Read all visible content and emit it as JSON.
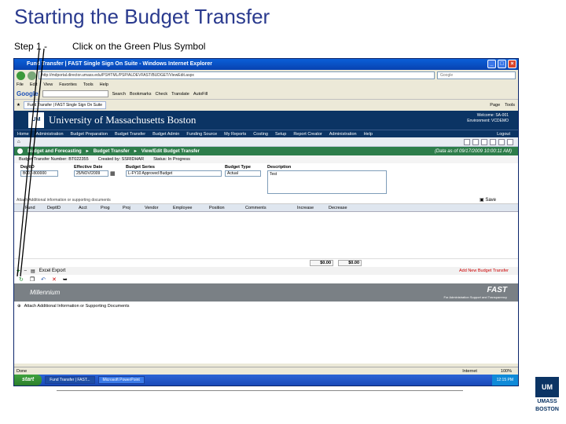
{
  "slide": {
    "title": "Starting the Budget Transfer",
    "step_label": "Step 1 -",
    "step_text": "Click on the Green Plus Symbol"
  },
  "browser": {
    "window_title": "Fund Transfer | FAST Single Sign On Suite - Windows Internet Explorer",
    "address": "http://mdportal.director.umass.edu/PSHTML/PSP/ALDEVFAST/BUDGET/ViewEdit.aspx",
    "search_placeholder": "Google",
    "menu": [
      "File",
      "Edit",
      "View",
      "Favorites",
      "Tools",
      "Help"
    ],
    "google_label": "Google",
    "google_tools": [
      "Search",
      "Bookmarks",
      "Check",
      "Translate",
      "AutoFill"
    ],
    "fav_tab": "Fund Transfer | FAST Single Sign On Suite",
    "fav_tools": [
      "Page",
      "Tools"
    ]
  },
  "app": {
    "university": "University of Massachusetts Boston",
    "user_lines": [
      "Welcome: SA-001",
      "Environment: VCDEMO"
    ],
    "nav": [
      "Home",
      "Administration",
      "Budget Preparation",
      "Budget Transfer",
      "Budget Admin",
      "Funding Source",
      "My Reports",
      "Costing",
      "Setup",
      "Report Creator",
      "Administration",
      "Help"
    ],
    "nav_right": "Logout",
    "breadcrumb": [
      "Budget and Forecasting",
      "Budget Transfer",
      "View/Edit Budget Transfer"
    ],
    "breadcrumb_date": "(Data as of 09/17/2009 10:00:11 AM)",
    "info": {
      "number": "Budget Transfer Number: BT022355",
      "created": "Created by: SSRIDHAR",
      "status": "Status: In Progress"
    },
    "form": {
      "deptid_label": "DeptID",
      "deptid_value": "B001-800000",
      "effdate_label": "Effective Date",
      "effdate_value": "25/NOV/2009",
      "series_label": "Budget Series",
      "series_value": "L-FY10 Approved Budget",
      "type_label": "Budget Type",
      "type_value": "Actual",
      "desc_label": "Description",
      "desc_value": "Test"
    },
    "attach_hint": "Attach Additional information or supporting documents",
    "save_label": "Save",
    "grid_columns": [
      "Fund",
      "DeptID",
      "Acct",
      "Prog",
      "Proj",
      "Vendor",
      "Employee",
      "Position",
      "Comments",
      "Increase",
      "Decrease"
    ],
    "total_increase": "$0.00",
    "total_decrease": "$0.00",
    "excel_export": "Excel Export",
    "add_new": "Add New Budget Transfer",
    "footer_left": "Millennium",
    "footer_brand": "FAST",
    "footer_sub": "For Administration Support and Transparency",
    "attach_bottom": "Attach Additional Information or Supporting Documents"
  },
  "status": {
    "left": "Done",
    "zone": "Internet",
    "zoom": "100%"
  },
  "taskbar": {
    "start": "start",
    "tasks": [
      "Fund Transfer | FAST...",
      "Microsoft PowerPoint"
    ],
    "clock": "12:15 PM"
  },
  "corner": {
    "mark": "UM",
    "line1": "UMASS",
    "line2": "BOSTON"
  },
  "colors": {
    "title_blue": "#2a3a8e",
    "umass_navy": "#0b3464",
    "breadcrumb_green": "#2d7d4a",
    "plus_green": "#1b8a2c"
  }
}
